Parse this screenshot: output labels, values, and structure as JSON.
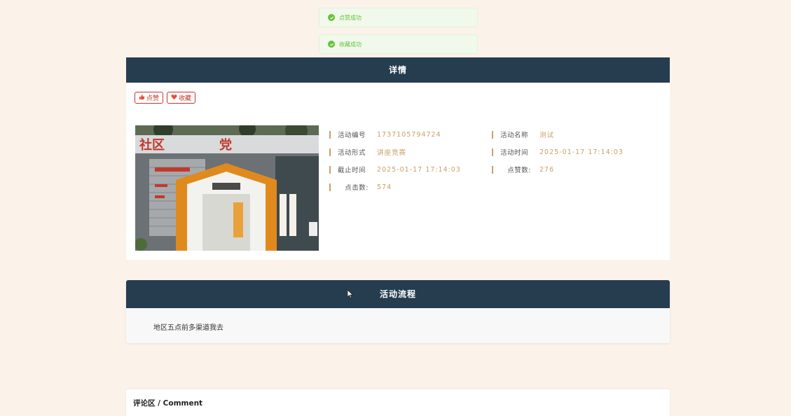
{
  "toasts": {
    "like_success": "点赞成功",
    "favorite_success": "收藏成功"
  },
  "detail": {
    "header": "详情",
    "like_button": "点赞",
    "favorite_button": "收藏",
    "fields": {
      "activity_id_label": "活动编号",
      "activity_id_value": "1737105794724",
      "activity_name_label": "活动名称",
      "activity_name_value": "测试",
      "activity_form_label": "活动形式",
      "activity_form_value": "讲座竞赛",
      "activity_time_label": "活动时间",
      "activity_time_value": "2025-01-17 17:14:03",
      "deadline_label": "截止时间",
      "deadline_value": "2025-01-17 17:14:03",
      "likes_label": "点赞数:",
      "likes_value": "276",
      "clicks_label": "点击数:",
      "clicks_value": "574"
    }
  },
  "process": {
    "header": "活动流程",
    "text": "地区五点前多渠道我去"
  },
  "comments": {
    "title": "评论区 / Comment"
  },
  "colors": {
    "page_bg": "#fbf2ea",
    "header_bg": "#263d50",
    "accent_gold": "#c9a06a",
    "button_red": "#c0392b",
    "success_green": "#67c23a"
  }
}
